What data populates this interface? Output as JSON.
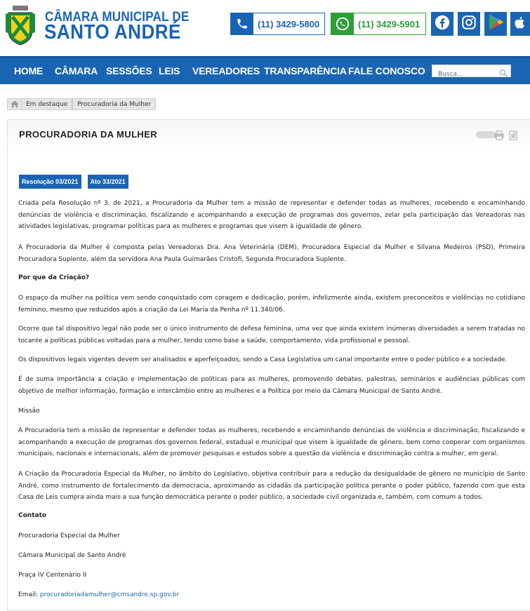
{
  "header": {
    "logo_line1": "CÂMARA MUNICIPAL DE",
    "logo_line2": "SANTO ANDRÉ",
    "phone1": "(11) 3429-5800",
    "phone2": "(11) 3429-5901",
    "social": [
      "facebook-icon",
      "instagram-icon",
      "google-play-icon",
      "apple-icon"
    ]
  },
  "nav": {
    "items": [
      "HOME",
      "CÂMARA",
      "SESSÕES",
      "LEIS",
      "VEREADORES",
      "TRANSPARÊNCIA",
      "FALE CONOSCO"
    ],
    "search_placeholder": "Busca..."
  },
  "breadcrumb": [
    "Em destaque",
    "Procuradoria da Mulher"
  ],
  "page": {
    "title": "PROCURADORIA DA MULHER",
    "badges": [
      "Resolução 03/2021",
      "Ato 33/2021"
    ],
    "paragraphs": [
      "Criada pela Resolução nº 3, de 2021, a Procuradoria da Mulher tem a missão de representar e defender todas as mulheres, recebendo e encaminhando denúncias de violência e discriminação, fiscalizando e acompanhando a execução de programas dos governos, zelar pela participação das Vereadoras nas atividades legislativas, programar políticas para as mulheres e programas que visem à igualdade de gênero.",
      "A Procuradoria da Mulher é composta pelas Vereadoras Dra. Ana Veterinária (DEM), Procuradora Especial da Mulher e Silvana Medeiros (PSD), Primeira Procuradora Suplente, além da servidora Ana Paula Guimarães Cristofi, Segunda Procuradora Suplente.",
      "Por que da Criação?",
      "O espaço da mulher na política vem sendo conquistado com coragem e dedicação, porém, infelizmente ainda, existem preconceitos e violências no cotidiano feminino, mesmo que reduzidos após a criação da Lei Maria da Penha nº 11.340/06.",
      "Ocorre que tal dispositivo legal não pode ser o único instrumento de defesa feminina, uma vez que ainda existem inúmeras diversidades a serem tratadas no tocante a políticas públicas voltadas para a mulher, tendo como base a saúde, comportamento, vida profissional e pessoal.",
      "Os dispositivos legais vigentes devem ser analisados e aperfeiçoados, sendo a Casa Legislativa um canal importante entre o poder público e a sociedade.",
      "É de suma importância a criação e implementação de políticas para as mulheres, promovendo debates, palestras, seminários e audiências públicas com objetivo de melhor informação, formação e intercâmbio entre as mulheres e a Política por meio da Câmara Municipal de Santo André.",
      "Missão",
      "A Procuradoria tem a missão de representar e defender todas as mulheres, recebendo e encaminhando denúncias de violência e discriminação, fiscalizando e acompanhando a execução de programas dos governos federal, estadual e municipal que visem à igualdade de gênero, bem como cooperar com organismos municipais, nacionais e internacionais, além de promover pesquisas e estudos sobre a questão da violência e discriminação contra a mulher, em geral.",
      "A Criação da Procuradoria Especial da Mulher, no âmbito do Legislativo, objetiva contribuir para a redução da desigualdade de gênero no município de Santo André, como instrumento de fortalecimento da democracia, aproximando as cidadãs da participação política perante o poder público, fazendo com que esta Casa de Leis cumpra ainda mais a sua função democrática perante o poder público, a sociedade civil organizada e, também, com comum a todos."
    ],
    "contact": {
      "heading": "Contato",
      "line1": "Procuradoria Especial da Mulher",
      "line2": "Câmara Municipal de Santo André",
      "line3": "Praça IV Centenário II",
      "email_label": "Email: ",
      "email": "procuradoriadamulher@cmsandre.sp.gov.br"
    }
  },
  "colors": {
    "brand_blue": "#1a64b4",
    "whatsapp_green": "#2e9d3a"
  }
}
